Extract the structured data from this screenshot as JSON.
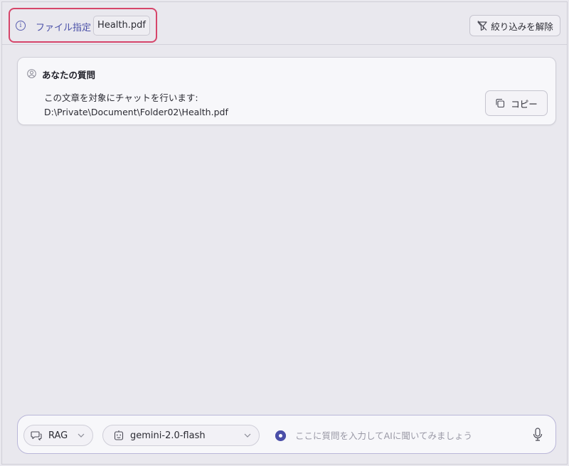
{
  "header": {
    "file_label": "ファイル指定",
    "file_chip": "Health.pdf",
    "clear_button": "絞り込みを解除",
    "highlight_color": "#d6456a"
  },
  "question": {
    "title": "あなたの質問",
    "line1": "この文章を対象にチャットを行います:",
    "line2": "D:\\Private\\Document\\Folder02\\Health.pdf",
    "copy_button": "コピー"
  },
  "input_bar": {
    "mode": "RAG",
    "model": "gemini-2.0-flash",
    "placeholder": "ここに質問を入力してAIに聞いてみましょう"
  },
  "icons": {
    "info": "info-icon",
    "filter_off": "filter-off-icon",
    "user": "user-icon",
    "copy": "copy-icon",
    "chat": "chat-icon",
    "robot": "robot-icon",
    "chevron": "chevron-down-icon",
    "mic": "mic-icon"
  },
  "colors": {
    "accent": "#4b51a8",
    "background": "#e9e8ee",
    "card": "#f7f7fa"
  }
}
